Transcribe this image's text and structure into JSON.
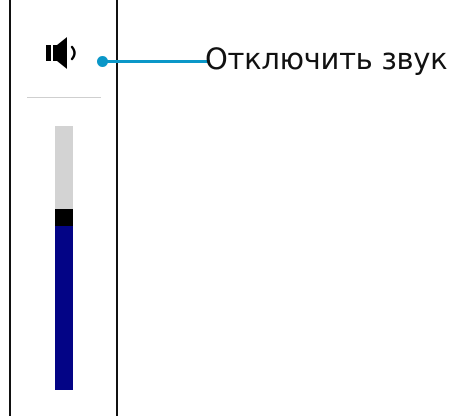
{
  "volume_panel": {
    "mute_button_icon": "speaker-icon",
    "volume_level_fraction": 0.62
  },
  "callout": {
    "label": "Отключить звук",
    "color": "#0a97c8"
  },
  "colors": {
    "track": "#d3d3d3",
    "fill": "#030486",
    "thumb": "#000000",
    "panel_border": "#111111"
  }
}
